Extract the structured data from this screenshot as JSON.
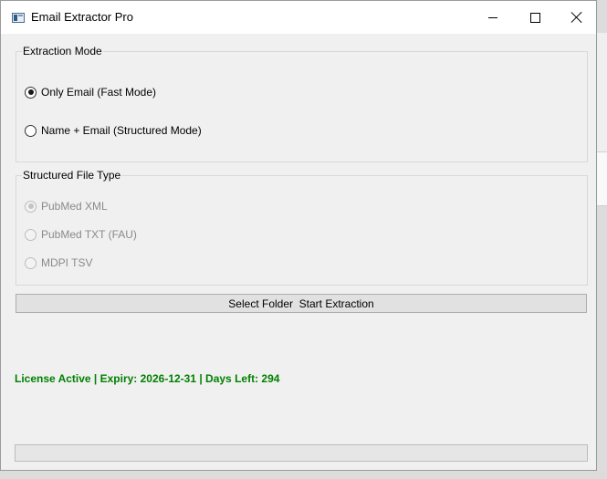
{
  "window": {
    "title": "Email Extractor Pro",
    "icon": "app-window-icon"
  },
  "extraction_mode": {
    "title": "Extraction Mode",
    "options": [
      {
        "label": "Only Email (Fast Mode)",
        "checked": true,
        "enabled": true
      },
      {
        "label": "Name + Email (Structured Mode)",
        "checked": false,
        "enabled": true
      }
    ]
  },
  "file_type": {
    "title": "Structured File Type",
    "options": [
      {
        "label": "PubMed XML",
        "checked": true,
        "enabled": false
      },
      {
        "label": "PubMed TXT (FAU)",
        "checked": false,
        "enabled": false
      },
      {
        "label": "MDPI TSV",
        "checked": false,
        "enabled": false
      }
    ]
  },
  "action": {
    "label": "Select Folder  Start Extraction"
  },
  "license": {
    "text": "License Active | Expiry: 2026-12-31 | Days Left: 294",
    "color": "#008000"
  },
  "progress": {
    "value": 0
  }
}
